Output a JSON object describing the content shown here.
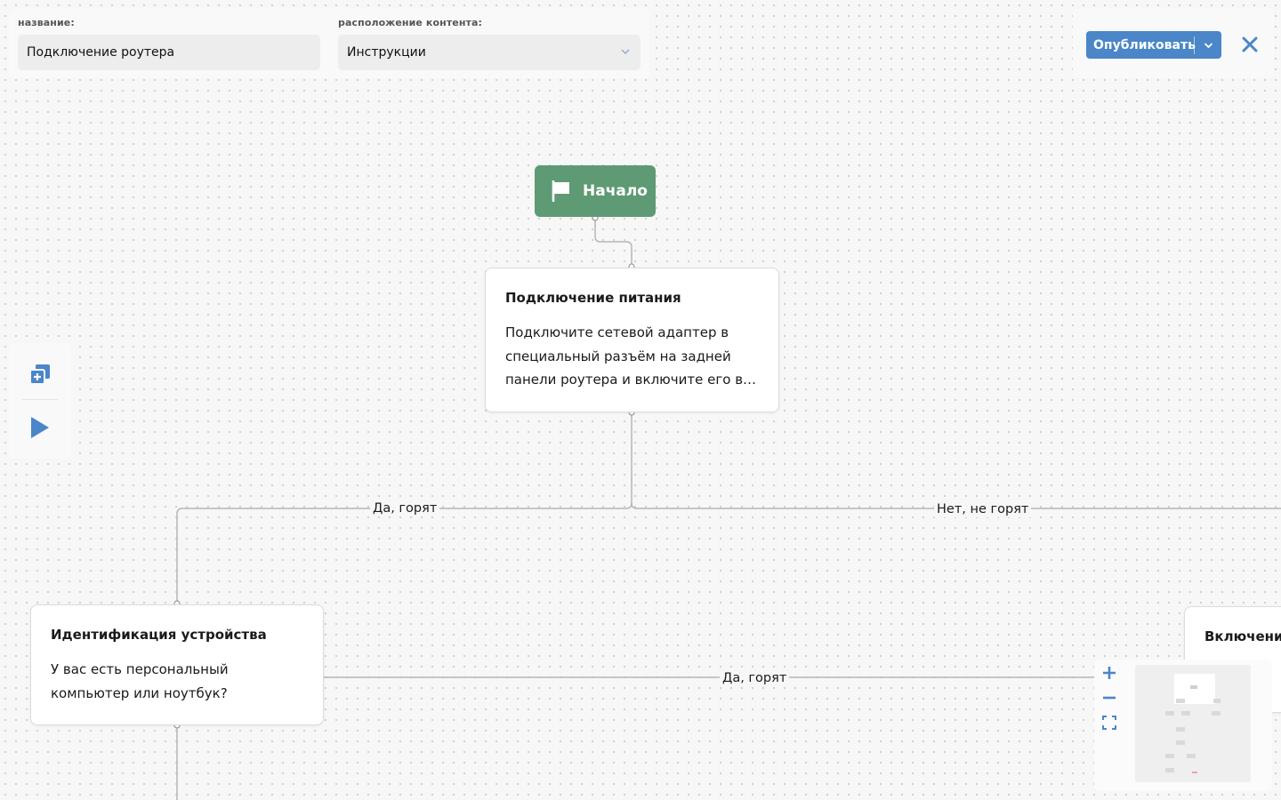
{
  "header": {
    "name_label": "название:",
    "name_value": "Подключение роутера",
    "location_label": "расположение контента:",
    "location_value": "Инструкции",
    "publish_label": "Опубликовать"
  },
  "flow": {
    "start_label": "Начало",
    "nodes": [
      {
        "title": "Подключение питания",
        "body": "Подключите сетевой адаптер в специальный разъём на задней панели роутера и включите его в…"
      },
      {
        "title": "Идентификация устройства",
        "body": "У вас есть персональный компьютер или ноутбук?"
      },
      {
        "title": "Включение"
      }
    ],
    "edge_labels": [
      "Да, горят",
      "Нет, не горят",
      "Да, горят"
    ]
  },
  "colors": {
    "accent": "#4a86c8",
    "start_node": "#5e9a73",
    "connector": "#b5b5b5"
  },
  "icons": [
    "chevron-down-icon",
    "close-icon",
    "add-node-icon",
    "play-icon",
    "flag-icon",
    "zoom-in-icon",
    "zoom-out-icon",
    "fit-screen-icon"
  ]
}
